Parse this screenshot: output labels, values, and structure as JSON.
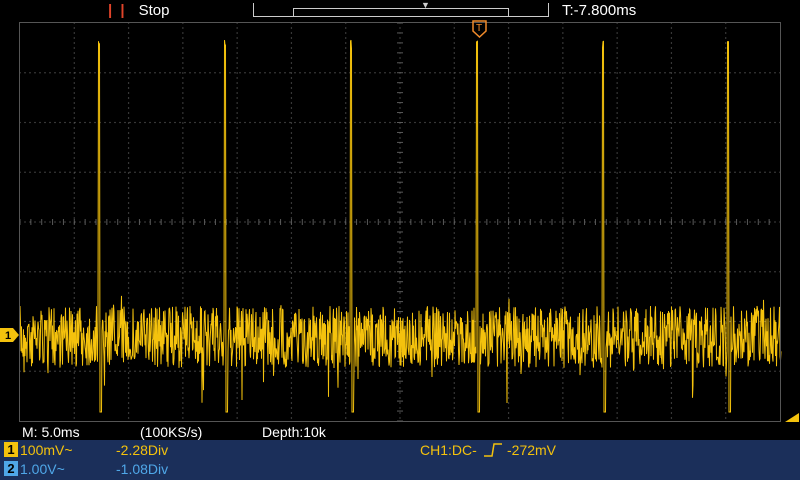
{
  "header": {
    "run_state": "Stop",
    "trigger_time": "T:-7.800ms"
  },
  "status": {
    "timebase": "M: 5.0ms",
    "sample_rate": "(100KS/s)",
    "depth": "Depth:10k"
  },
  "channels": [
    {
      "id": "1",
      "scale": "100mV~",
      "offset": "-2.28Div",
      "color": "#f4c20d"
    },
    {
      "id": "2",
      "scale": "1.00V~",
      "offset": "-1.08Div",
      "color": "#4fa7e8"
    }
  ],
  "trigger": {
    "source": "CH1:DC-",
    "level": "-272mV"
  },
  "markers": {
    "trigger_label": "T",
    "ch1_label": "1"
  },
  "colors": {
    "trace": "#f4c20d",
    "grid": "#5a5a5a",
    "bottom_bar": "#1b2f5a",
    "stop_icon": "#e0442a"
  }
}
